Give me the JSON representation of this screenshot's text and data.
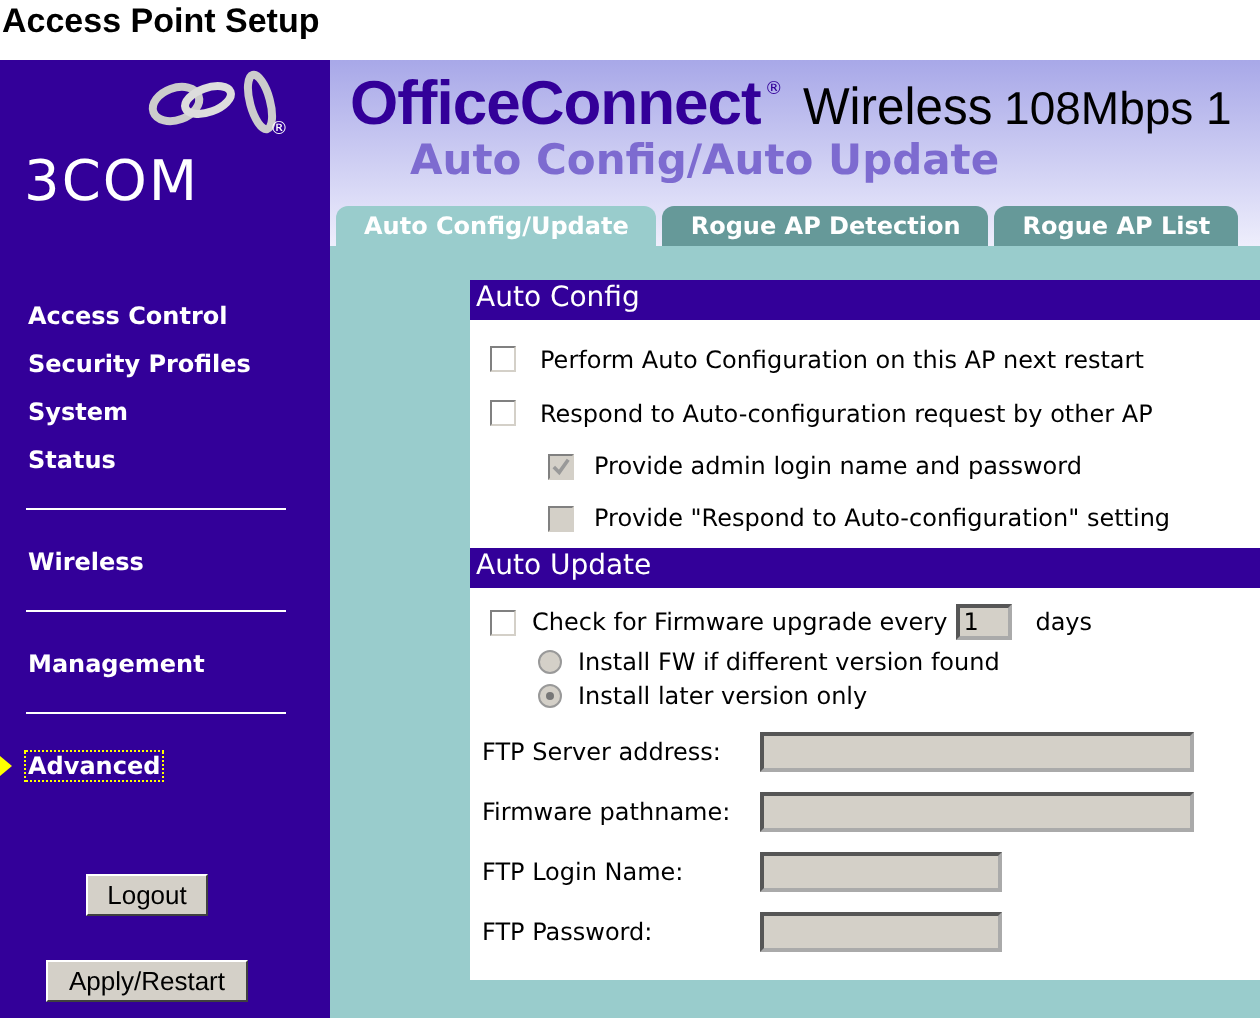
{
  "page_title": "Access Point Setup",
  "brand": {
    "logo": "3COM",
    "product": "OfficeConnect",
    "registered": "®",
    "product_line": "Wireless",
    "speed": "108Mbps 1"
  },
  "page_heading": "Auto Config/Auto Update",
  "tabs": [
    {
      "label": "Auto Config/Update",
      "selected": true
    },
    {
      "label": "Rogue AP Detection",
      "selected": false
    },
    {
      "label": "Rogue AP List",
      "selected": false
    }
  ],
  "sidebar": {
    "groups": [
      {
        "items": [
          {
            "label": "Access Control",
            "selected": false
          },
          {
            "label": "Security Profiles",
            "selected": false
          },
          {
            "label": "System",
            "selected": false
          },
          {
            "label": "Status",
            "selected": false
          }
        ]
      },
      {
        "items": [
          {
            "label": "Wireless",
            "selected": false
          }
        ]
      },
      {
        "items": [
          {
            "label": "Management",
            "selected": false
          }
        ]
      },
      {
        "items": [
          {
            "label": "Advanced",
            "selected": true
          }
        ]
      }
    ],
    "buttons": [
      "Logout",
      "Apply/Restart"
    ]
  },
  "auto_config": {
    "title": "Auto Config",
    "options": [
      {
        "label": "Perform Auto Configuration on this AP next restart",
        "checked": false,
        "disabled": false
      },
      {
        "label": "Respond to Auto-configuration request by other AP",
        "checked": false,
        "disabled": false,
        "children": [
          {
            "label": "Provide admin login name and password",
            "checked": true,
            "disabled": true
          },
          {
            "label": "Provide \"Respond to Auto-configuration\" setting",
            "checked": false,
            "disabled": true
          }
        ]
      }
    ]
  },
  "auto_update": {
    "title": "Auto Update",
    "check": {
      "label": "Check for Firmware upgrade every",
      "checked": false,
      "value": "1",
      "unit": "days"
    },
    "radios": [
      {
        "label": "Install FW if different version found",
        "selected": false,
        "disabled": true
      },
      {
        "label": "Install later version only",
        "selected": true,
        "disabled": true
      }
    ],
    "fields": [
      {
        "label": "FTP Server address:",
        "kind": "wide",
        "disabled": true
      },
      {
        "label": "Firmware pathname:",
        "kind": "wide",
        "disabled": true
      },
      {
        "label": "FTP Login Name:",
        "kind": "narrow",
        "disabled": true
      },
      {
        "label": "FTP Password:",
        "kind": "narrow",
        "disabled": true
      }
    ]
  }
}
